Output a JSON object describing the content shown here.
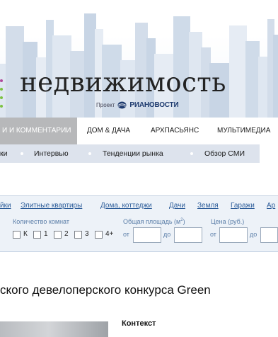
{
  "header": {
    "title": "недвижимость",
    "project_label": "Проект",
    "project_brand": "РИАНОВОСТИ",
    "brand_colors": {
      "logo_green": "#7cc242",
      "logo_purple": "#b04a9c",
      "ria_blue": "#1d3a6e"
    }
  },
  "nav_main": {
    "items": [
      {
        "label": "И И КОММЕНТАРИИ",
        "active": true
      },
      {
        "label": "ДОМ & ДАЧА",
        "active": false
      },
      {
        "label": "АРХПАСЬЯНС",
        "active": false
      },
      {
        "label": "МУЛЬТИМЕДИА",
        "active": false
      }
    ],
    "active_color": "#b7b8ba"
  },
  "nav_sub": {
    "items": [
      {
        "label": "ки"
      },
      {
        "label": "Интервью"
      },
      {
        "label": "Тенденции рынка"
      },
      {
        "label": "Обзор СМИ"
      }
    ],
    "background": "#dde3ed"
  },
  "search": {
    "categories": [
      "йки",
      "Элитные квартиры",
      "Дома, коттеджи",
      "Дачи",
      "Земля",
      "Гаражи",
      "Ар"
    ],
    "rooms": {
      "label": "Количество комнат",
      "options": [
        {
          "label": "К",
          "checked": false
        },
        {
          "label": "1",
          "checked": false
        },
        {
          "label": "2",
          "checked": false
        },
        {
          "label": "3",
          "checked": false
        },
        {
          "label": "4+",
          "checked": false
        }
      ]
    },
    "area": {
      "label": "Общая площадь (м",
      "unit_sup": "2",
      "label_end": ")",
      "from_label": "от",
      "to_label": "до",
      "from_value": "",
      "to_value": ""
    },
    "price": {
      "label": "Цена (руб.)",
      "from_label": "от",
      "to_label": "до",
      "from_value": "",
      "to_value": ""
    }
  },
  "article": {
    "headline": "ского девелоперского конкурса Green"
  },
  "sidebar": {
    "context_title": "Контекст"
  }
}
